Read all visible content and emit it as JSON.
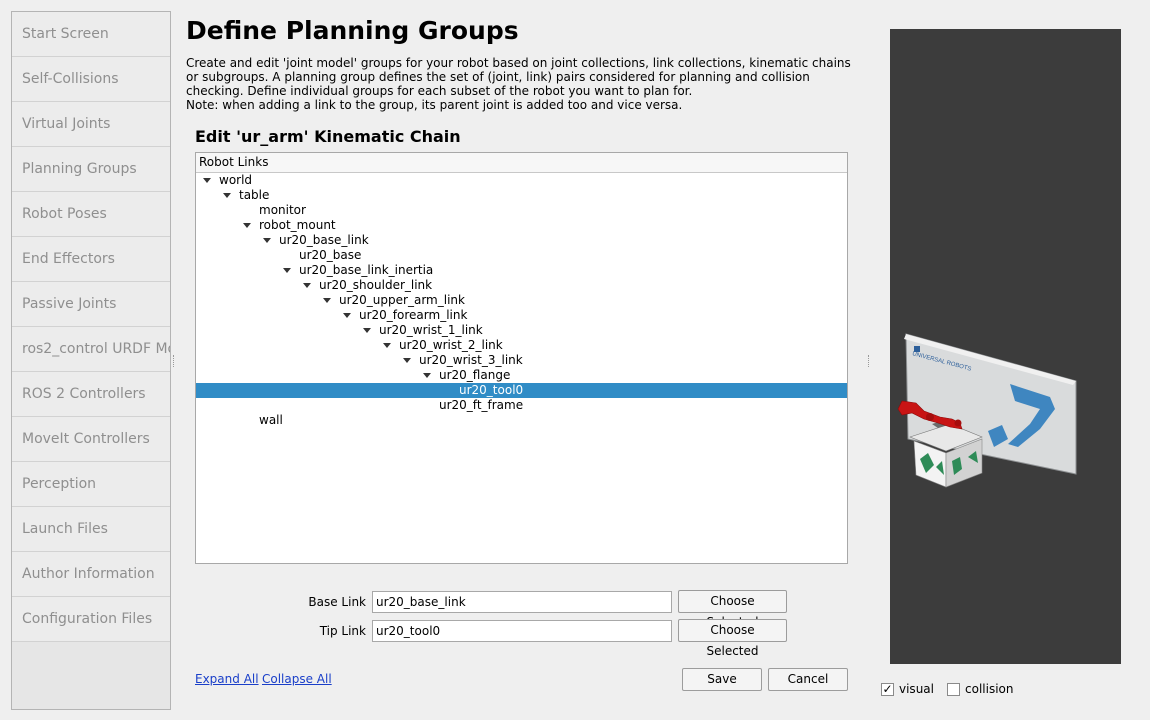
{
  "sidebar": {
    "items": [
      {
        "label": "Start Screen"
      },
      {
        "label": "Self-Collisions"
      },
      {
        "label": "Virtual Joints"
      },
      {
        "label": "Planning Groups"
      },
      {
        "label": "Robot Poses"
      },
      {
        "label": "End Effectors"
      },
      {
        "label": "Passive Joints"
      },
      {
        "label": "ros2_control URDF Mo"
      },
      {
        "label": "ROS 2 Controllers"
      },
      {
        "label": "MoveIt Controllers"
      },
      {
        "label": "Perception"
      },
      {
        "label": "Launch Files"
      },
      {
        "label": "Author Information"
      },
      {
        "label": "Configuration Files"
      }
    ]
  },
  "main": {
    "title": "Define Planning Groups",
    "description_line1": "Create and edit 'joint model' groups for your robot based on joint collections, link collections, kinematic chains or subgroups. A planning group defines the set of (joint, link) pairs considered for planning and collision checking. Define individual groups for each subset of the robot you want to plan for.",
    "description_line2": "Note: when adding a link to the group, its parent joint is added too and vice versa.",
    "edit_title": "Edit 'ur_arm' Kinematic Chain",
    "tree_header": "Robot Links",
    "tree": [
      {
        "label": "world",
        "depth": 0,
        "expanded": true
      },
      {
        "label": "table",
        "depth": 1,
        "expanded": true
      },
      {
        "label": "monitor",
        "depth": 2,
        "expanded": false
      },
      {
        "label": "robot_mount",
        "depth": 2,
        "expanded": true
      },
      {
        "label": "ur20_base_link",
        "depth": 3,
        "expanded": true
      },
      {
        "label": "ur20_base",
        "depth": 4,
        "expanded": false
      },
      {
        "label": "ur20_base_link_inertia",
        "depth": 4,
        "expanded": true
      },
      {
        "label": "ur20_shoulder_link",
        "depth": 5,
        "expanded": true
      },
      {
        "label": "ur20_upper_arm_link",
        "depth": 6,
        "expanded": true
      },
      {
        "label": "ur20_forearm_link",
        "depth": 7,
        "expanded": true
      },
      {
        "label": "ur20_wrist_1_link",
        "depth": 8,
        "expanded": true
      },
      {
        "label": "ur20_wrist_2_link",
        "depth": 9,
        "expanded": true
      },
      {
        "label": "ur20_wrist_3_link",
        "depth": 10,
        "expanded": true
      },
      {
        "label": "ur20_flange",
        "depth": 11,
        "expanded": true
      },
      {
        "label": "ur20_tool0",
        "depth": 12,
        "expanded": false,
        "selected": true
      },
      {
        "label": "ur20_ft_frame",
        "depth": 11,
        "expanded": false
      },
      {
        "label": "wall",
        "depth": 2,
        "expanded": false
      }
    ],
    "base_link_label": "Base Link",
    "base_link_value": "ur20_base_link",
    "tip_link_label": "Tip Link",
    "tip_link_value": "ur20_tool0",
    "choose_selected": "Choose Selected",
    "expand_all": "Expand All",
    "collapse_all": "Collapse All",
    "save": "Save",
    "cancel": "Cancel"
  },
  "viewer": {
    "visual_label": "visual",
    "visual_checked": true,
    "collision_label": "collision",
    "collision_checked": false,
    "monitor_text": "UNIVERSAL ROBOTS"
  },
  "colors": {
    "selection": "#308cc6",
    "viewer_bg": "#3c3c3c",
    "robot": "#d01515"
  }
}
